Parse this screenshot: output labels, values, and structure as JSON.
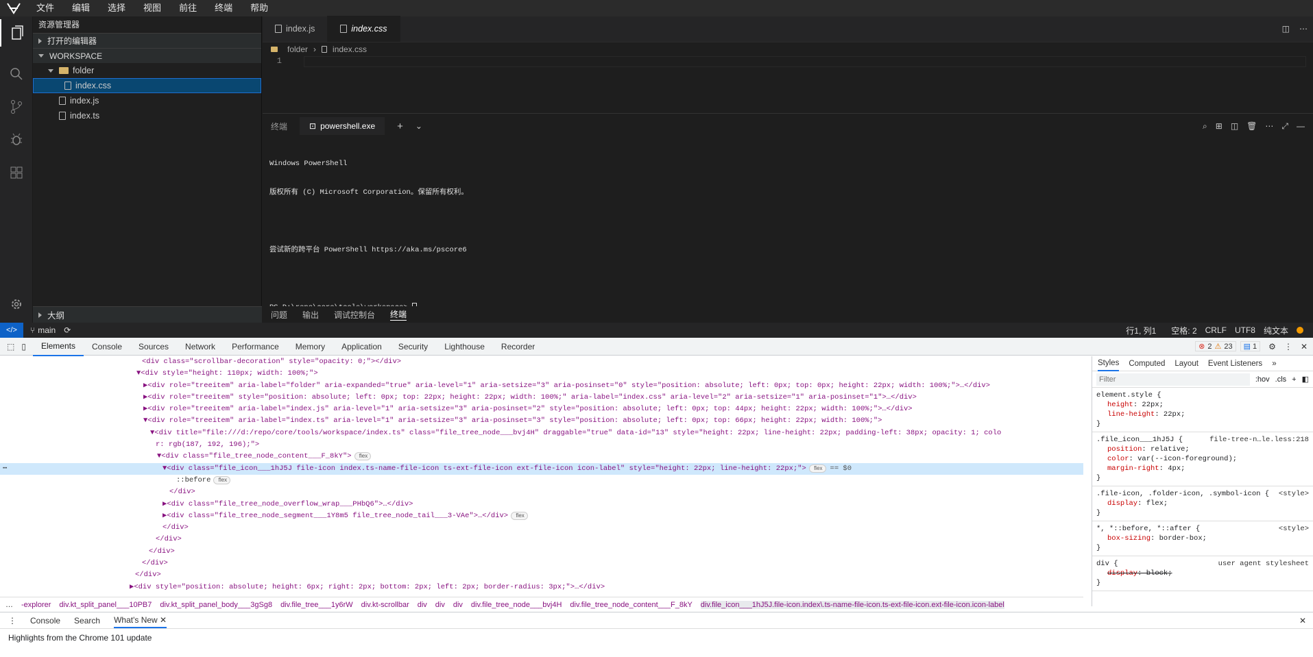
{
  "menu": {
    "items": [
      "文件",
      "编辑",
      "选择",
      "视图",
      "前往",
      "终端",
      "帮助"
    ]
  },
  "sidebar": {
    "title": "资源管理器",
    "open_editors": "打开的编辑器",
    "workspace": "WORKSPACE",
    "folder": "folder",
    "files": [
      "index.css",
      "index.js",
      "index.ts"
    ],
    "outline": "大纲"
  },
  "editor": {
    "tabs": [
      "index.js",
      "index.css"
    ],
    "crumb_folder": "folder",
    "crumb_file": "index.css",
    "line_no": "1"
  },
  "panel": {
    "terminal_label": "终端",
    "shell": "powershell.exe",
    "terminal_lines": [
      "Windows PowerShell",
      "版权所有 (C) Microsoft Corporation。保留所有权利。",
      "",
      "尝试新的跨平台 PowerShell https://aka.ms/pscore6",
      "",
      "PS D:\\repo\\core\\tools\\workspace> "
    ],
    "bottom_tabs": [
      "问题",
      "输出",
      "调试控制台",
      "终端"
    ]
  },
  "status": {
    "branch": "main",
    "position": "行1, 列1",
    "spaces": "空格: 2",
    "eol": "CRLF",
    "encoding": "UTF8",
    "lang": "纯文本"
  },
  "devtools": {
    "tabs": [
      "Elements",
      "Console",
      "Sources",
      "Network",
      "Performance",
      "Memory",
      "Application",
      "Security",
      "Lighthouse",
      "Recorder"
    ],
    "errors": "2",
    "warnings": "23",
    "messages": "1",
    "dom_lines": [
      "<div class=\"scrollbar-decoration\" style=\"opacity: 0;\"></div>",
      "▼<div style=\"height: 110px; width: 100%;\">",
      "▶<div role=\"treeitem\" aria-label=\"folder\" aria-expanded=\"true\" aria-level=\"1\" aria-setsize=\"3\" aria-posinset=\"0\" style=\"position: absolute; left: 0px; top: 0px; height: 22px; width: 100%;\">…</div>",
      "▶<div role=\"treeitem\" style=\"position: absolute; left: 0px; top: 22px; height: 22px; width: 100%;\" aria-label=\"index.css\" aria-level=\"2\" aria-setsize=\"1\" aria-posinset=\"1\">…</div>",
      "▶<div role=\"treeitem\" aria-label=\"index.js\" aria-level=\"1\" aria-setsize=\"3\" aria-posinset=\"2\" style=\"position: absolute; left: 0px; top: 44px; height: 22px; width: 100%;\">…</div>",
      "▼<div role=\"treeitem\" aria-label=\"index.ts\" aria-level=\"1\" aria-setsize=\"3\" aria-posinset=\"3\" style=\"position: absolute; left: 0px; top: 66px; height: 22px; width: 100%;\">",
      "▼<div title=\"file:///d:/repo/core/tools/workspace/index.ts\" class=\"file_tree_node___bvj4H\" draggable=\"true\" data-id=\"13\" style=\"height: 22px; line-height: 22px; padding-left: 38px; opacity: 1; colo",
      "r: rgb(187, 192, 196);\">",
      "▼<div class=\"file_tree_node_content___F_8kY\">",
      "▼<div class=\"file_icon___1hJ5J file-icon index.ts-name-file-icon ts-ext-file-icon ext-file-icon icon-label\" style=\"height: 22px; line-height: 22px;\">",
      "::before",
      "</div>",
      "▶<div class=\"file_tree_node_overflow_wrap___PHbQ6\">…</div>",
      "▶<div class=\"file_tree_node_segment___1Y8m5 file_tree_node_tail___3-VAe\">…</div>",
      "</div>",
      "</div>",
      "</div>",
      "</div>",
      "</div>",
      "▶<div style=\"position: absolute; height: 6px; right: 2px; bottom: 2px; left: 2px; border-radius: 3px;\">…</div>"
    ],
    "flex_badge": "flex",
    "dollar0": "== $0",
    "crumbs": [
      "-explorer",
      "div.kt_split_panel___10PB7",
      "div.kt_split_panel_body___3gSg8",
      "div.file_tree___1y6rW",
      "div.kt-scrollbar",
      "div",
      "div",
      "div",
      "div.file_tree_node___bvj4H",
      "div.file_tree_node_content___F_8kY",
      "div.file_icon___1hJ5J.file-icon.index\\.ts-name-file-icon.ts-ext-file-icon.ext-file-icon.icon-label"
    ],
    "styles_tabs": [
      "Styles",
      "Computed",
      "Layout",
      "Event Listeners"
    ],
    "filter_placeholder": "Filter",
    "hov": ":hov",
    "cls": ".cls",
    "rules": [
      {
        "sel": "element.style {",
        "src": "",
        "props": [
          [
            "height",
            "22px;"
          ],
          [
            "line-height",
            "22px;"
          ]
        ]
      },
      {
        "sel": ".file_icon___1hJ5J {",
        "src": "file-tree-n…le.less:218",
        "props": [
          [
            "position",
            "relative;"
          ],
          [
            "color",
            "var(--icon-foreground);"
          ],
          [
            "margin-right",
            "4px;"
          ]
        ]
      },
      {
        "sel": ".file-icon, .folder-icon, .symbol-icon {",
        "src": "<style>",
        "props": [
          [
            "display",
            "flex;"
          ]
        ]
      },
      {
        "sel": "*, *::before, *::after {",
        "src": "<style>",
        "props": [
          [
            "box-sizing",
            "border-box;"
          ]
        ]
      },
      {
        "sel": "div {",
        "src": "user agent stylesheet",
        "props": [
          [
            "display",
            "block;"
          ]
        ]
      }
    ],
    "drawer_tabs": [
      "Console",
      "Search",
      "What's New"
    ],
    "drawer_text": "Highlights from the Chrome 101 update"
  }
}
